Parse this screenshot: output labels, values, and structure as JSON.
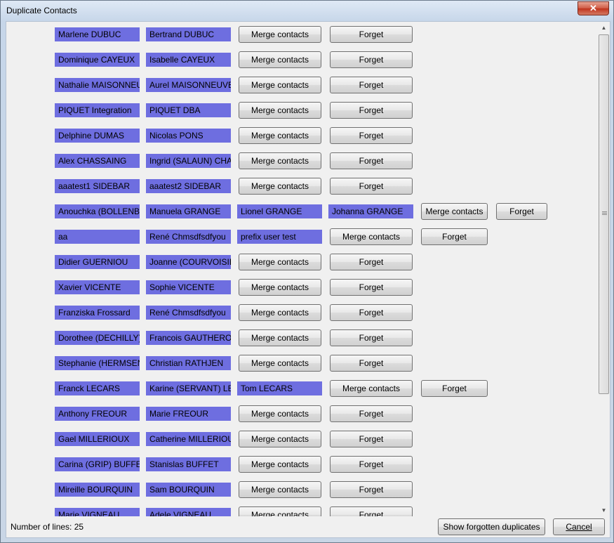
{
  "window": {
    "title": "Duplicate Contacts",
    "close_glyph": "✕"
  },
  "rows": [
    {
      "names": [
        "Marlene DUBUC",
        "Bertrand DUBUC"
      ],
      "merge": "Merge contacts",
      "forget": "Forget"
    },
    {
      "names": [
        "Dominique CAYEUX",
        "Isabelle CAYEUX"
      ],
      "merge": "Merge contacts",
      "forget": "Forget"
    },
    {
      "names": [
        "Nathalie MAISONNEUVE",
        "Aurel MAISONNEUVE"
      ],
      "merge": "Merge contacts",
      "forget": "Forget"
    },
    {
      "names": [
        "PIQUET Integration",
        "PIQUET DBA"
      ],
      "merge": "Merge contacts",
      "forget": "Forget"
    },
    {
      "names": [
        "Delphine DUMAS",
        "Nicolas PONS"
      ],
      "merge": "Merge contacts",
      "forget": "Forget"
    },
    {
      "names": [
        "Alex CHASSAING",
        "Ingrid (SALAUN) CHASSAING"
      ],
      "merge": "Merge contacts",
      "forget": "Forget"
    },
    {
      "names": [
        "aaatest1 SIDEBAR",
        "aaatest2 SIDEBAR"
      ],
      "merge": "Merge contacts",
      "forget": "Forget"
    },
    {
      "names": [
        "Anouchka (BOLLENBACH) GRANGE",
        "Manuela GRANGE",
        "Lionel GRANGE",
        "Johanna GRANGE"
      ],
      "merge": "Merge contacts",
      "forget": "Forget"
    },
    {
      "names": [
        "aa",
        "René Chmsdfsdfyou",
        "prefix user test"
      ],
      "merge": "Merge contacts",
      "forget": "Forget"
    },
    {
      "names": [
        "Didier GUERNIOU",
        "Joanne (COURVOISIER) GUERNIOU"
      ],
      "merge": "Merge contacts",
      "forget": "Forget"
    },
    {
      "names": [
        "Xavier VICENTE",
        "Sophie VICENTE"
      ],
      "merge": "Merge contacts",
      "forget": "Forget"
    },
    {
      "names": [
        "Franziska  Frossard",
        "René Chmsdfsdfyou"
      ],
      "merge": "Merge contacts",
      "forget": "Forget"
    },
    {
      "names": [
        "Dorothee (DECHILLY) GAUTHERON",
        "Francois GAUTHERON"
      ],
      "merge": "Merge contacts",
      "forget": "Forget"
    },
    {
      "names": [
        "Stephanie (HERMSEN) RATHJEN",
        "Christian RATHJEN"
      ],
      "merge": "Merge contacts",
      "forget": "Forget"
    },
    {
      "names": [
        "Franck LECARS",
        "Karine (SERVANT) LECARS",
        "Tom LECARS"
      ],
      "merge": "Merge contacts",
      "forget": "Forget"
    },
    {
      "names": [
        "Anthony FREOUR",
        "Marie FREOUR"
      ],
      "merge": "Merge contacts",
      "forget": "Forget"
    },
    {
      "names": [
        "Gael MILLERIOUX",
        "Catherine MILLERIOUX"
      ],
      "merge": "Merge contacts",
      "forget": "Forget"
    },
    {
      "names": [
        "Carina (GRIP) BUFFET",
        "Stanislas BUFFET"
      ],
      "merge": "Merge contacts",
      "forget": "Forget"
    },
    {
      "names": [
        "Mireille BOURQUIN",
        "Sam BOURQUIN"
      ],
      "merge": "Merge contacts",
      "forget": "Forget"
    },
    {
      "names": [
        "Marie VIGNEAU",
        "Adele VIGNEAU"
      ],
      "merge": "Merge contacts",
      "forget": "Forget"
    }
  ],
  "footer": {
    "count_label": "Number of lines: 25",
    "show_forgotten": "Show forgotten duplicates",
    "cancel": "Cancel"
  },
  "colors": {
    "name_box": "#6e6ee0"
  }
}
